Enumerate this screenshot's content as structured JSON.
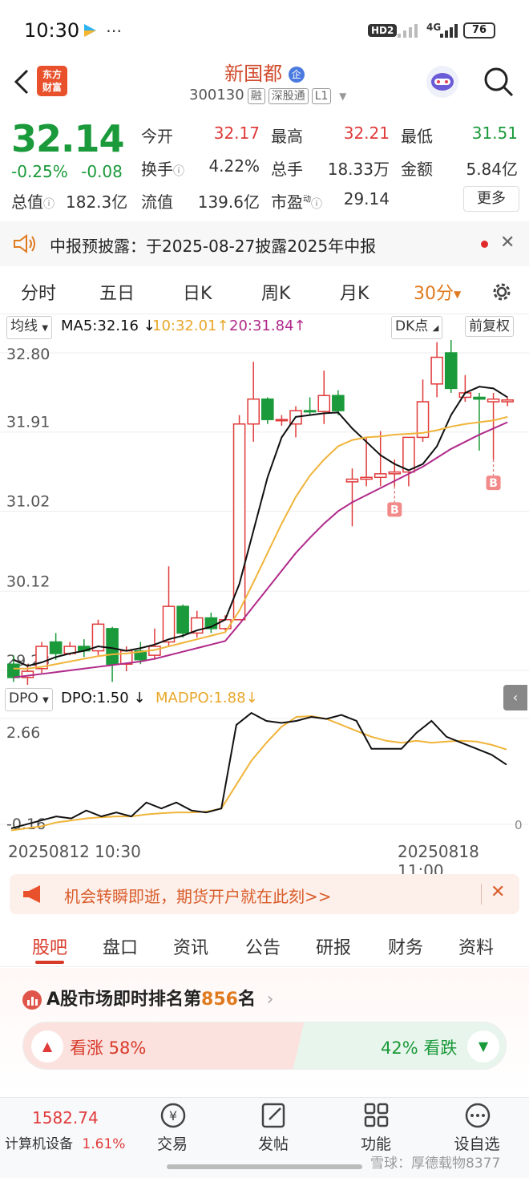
{
  "status": {
    "time": "10:30",
    "battery": "76",
    "signal_tag": "HD2",
    "network": "4G"
  },
  "header": {
    "logo_line1": "东方",
    "logo_line2": "财富",
    "name": "新国都",
    "badge": "企",
    "code": "300130",
    "tags": [
      "融",
      "深股通",
      "L1"
    ]
  },
  "quote": {
    "price": "32.14",
    "change_pct": "-0.25%",
    "change": "-0.08",
    "open_label": "今开",
    "open": "32.17",
    "high_label": "最高",
    "high": "32.21",
    "low_label": "最低",
    "low": "31.51",
    "turnover_label": "换手",
    "turnover": "4.22%",
    "volume_label": "总手",
    "volume": "18.33万",
    "amount_label": "金额",
    "amount": "5.84亿",
    "mktcap_label": "总值",
    "mktcap": "182.3亿",
    "float_label": "流值",
    "float": "139.6亿",
    "pe_label": "市盈",
    "pe_sup": "动",
    "pe": "29.14",
    "more": "更多"
  },
  "notice": {
    "text": "中报预披露：于2025-08-27披露2025年中报"
  },
  "tabs": [
    "分时",
    "五日",
    "日K",
    "周K",
    "月K",
    "30分"
  ],
  "ma": {
    "selector": "均线",
    "ma5": "MA5:32.16",
    "ma10": "10:32.01",
    "ma20": "20:31.84",
    "dk": "DK点",
    "adjust": "前复权"
  },
  "colors": {
    "up": "#e03a3a",
    "down": "#1a9a3a",
    "ma5": "#111111",
    "ma10": "#f0b43a",
    "ma20": "#b02a8a",
    "accent": "#e07a1f"
  },
  "chart_data": [
    {
      "type": "candlestick",
      "y_ticks": [
        "32.80",
        "31.91",
        "31.02",
        "30.12",
        "29.23"
      ],
      "ylim": [
        29.23,
        32.8
      ],
      "candles": [
        [
          29.3,
          29.15,
          29.1,
          29.4
        ],
        [
          29.15,
          29.22,
          29.05,
          29.3
        ],
        [
          29.25,
          29.5,
          29.2,
          29.55
        ],
        [
          29.55,
          29.42,
          29.35,
          29.65
        ],
        [
          29.42,
          29.5,
          29.4,
          29.55
        ],
        [
          29.5,
          29.45,
          29.38,
          29.58
        ],
        [
          29.45,
          29.75,
          29.4,
          29.8
        ],
        [
          29.7,
          29.3,
          29.1,
          29.72
        ],
        [
          29.3,
          29.45,
          29.22,
          29.5
        ],
        [
          29.45,
          29.35,
          29.3,
          29.55
        ],
        [
          29.4,
          29.5,
          29.35,
          29.7
        ],
        [
          29.55,
          29.95,
          29.5,
          30.4
        ],
        [
          29.95,
          29.65,
          29.6,
          29.97
        ],
        [
          29.65,
          29.82,
          29.6,
          29.9
        ],
        [
          29.82,
          29.7,
          29.65,
          29.88
        ],
        [
          29.7,
          29.8,
          29.68,
          29.85
        ],
        [
          29.8,
          32.0,
          29.8,
          32.1
        ],
        [
          32.0,
          32.28,
          31.8,
          32.7
        ],
        [
          32.28,
          32.05,
          32.0,
          32.3
        ],
        [
          32.05,
          32.05,
          31.98,
          32.1
        ],
        [
          32.0,
          32.15,
          31.85,
          32.2
        ],
        [
          32.15,
          32.14,
          32.1,
          32.3
        ],
        [
          32.14,
          32.32,
          32.0,
          32.6
        ],
        [
          32.32,
          32.15,
          32.1,
          32.38
        ],
        [
          31.35,
          31.38,
          30.85,
          31.5
        ],
        [
          31.38,
          31.4,
          31.3,
          31.85
        ],
        [
          31.4,
          31.44,
          31.3,
          31.92
        ],
        [
          31.44,
          31.46,
          31.3,
          31.6
        ],
        [
          31.46,
          31.85,
          31.3,
          31.85
        ],
        [
          31.85,
          32.25,
          31.8,
          32.5
        ],
        [
          32.45,
          32.75,
          32.3,
          32.92
        ],
        [
          32.8,
          32.4,
          32.35,
          32.95
        ],
        [
          32.3,
          32.35,
          32.25,
          32.55
        ],
        [
          32.3,
          32.28,
          31.7,
          32.35
        ],
        [
          32.25,
          32.28,
          31.6,
          32.35
        ],
        [
          32.25,
          32.27,
          32.2,
          32.3
        ]
      ],
      "ma5": [
        29.35,
        29.28,
        29.32,
        29.38,
        29.42,
        29.45,
        29.5,
        29.48,
        29.45,
        29.48,
        29.52,
        29.58,
        29.62,
        29.68,
        29.72,
        29.8,
        30.2,
        30.8,
        31.4,
        31.85,
        32.08,
        32.1,
        32.12,
        32.13,
        31.95,
        31.8,
        31.65,
        31.55,
        31.48,
        31.55,
        31.75,
        32.1,
        32.35,
        32.42,
        32.4,
        32.3
      ],
      "ma10": [
        29.25,
        29.25,
        29.27,
        29.3,
        29.33,
        29.36,
        29.39,
        29.41,
        29.42,
        29.44,
        29.46,
        29.5,
        29.54,
        29.58,
        29.62,
        29.66,
        29.9,
        30.22,
        30.55,
        30.88,
        31.18,
        31.42,
        31.6,
        31.75,
        31.82,
        31.85,
        31.86,
        31.88,
        31.89,
        31.9,
        31.93,
        31.97,
        32.0,
        32.02,
        32.04,
        32.08
      ],
      "ma20": [
        29.15,
        29.17,
        29.19,
        29.21,
        29.23,
        29.25,
        29.27,
        29.29,
        29.31,
        29.33,
        29.36,
        29.4,
        29.44,
        29.48,
        29.52,
        29.56,
        29.75,
        29.95,
        30.15,
        30.35,
        30.55,
        30.72,
        30.88,
        31.02,
        31.12,
        31.2,
        31.28,
        31.36,
        31.44,
        31.52,
        31.62,
        31.72,
        31.8,
        31.88,
        31.95,
        32.02
      ],
      "markers": [
        {
          "label": "B",
          "index": 27
        },
        {
          "label": "B",
          "index": 34
        }
      ]
    },
    {
      "type": "line",
      "name": "DPO",
      "labels": {
        "dpo": "DPO:1.50",
        "madpo": "MADPO:1.88"
      },
      "y_ticks": [
        "2.66",
        "-0.16"
      ],
      "right_tick": "0",
      "ylim": [
        -0.16,
        2.66
      ],
      "dpo": [
        -0.1,
        0.0,
        0.1,
        0.2,
        0.15,
        0.35,
        0.2,
        0.3,
        0.2,
        0.55,
        0.4,
        0.55,
        0.35,
        0.3,
        0.4,
        2.5,
        2.8,
        2.6,
        2.55,
        2.6,
        2.7,
        2.65,
        2.75,
        2.6,
        1.9,
        1.9,
        1.9,
        2.3,
        2.6,
        2.2,
        2.05,
        1.9,
        1.75,
        1.5
      ],
      "madpo": [
        -0.15,
        -0.1,
        -0.05,
        0.05,
        0.1,
        0.15,
        0.18,
        0.2,
        0.2,
        0.25,
        0.28,
        0.3,
        0.3,
        0.32,
        0.4,
        1.0,
        1.6,
        2.05,
        2.45,
        2.7,
        2.72,
        2.65,
        2.5,
        2.35,
        2.2,
        2.1,
        2.05,
        2.1,
        2.05,
        2.08,
        2.1,
        2.08,
        2.0,
        1.88
      ]
    }
  ],
  "date_range": {
    "start": "20250812 10:30",
    "end": "20250818 11:00"
  },
  "promo": {
    "text": "机会转瞬即逝，期货开户就在此刻>>"
  },
  "subtabs": [
    "股吧",
    "盘口",
    "资讯",
    "公告",
    "研报",
    "财务",
    "资料"
  ],
  "rank": {
    "prefix": "A股市场即时排名第",
    "num": "856",
    "suffix": "名"
  },
  "vote": {
    "up_label": "看涨 58%",
    "down_label": "42% 看跌",
    "up_fraction": 0.58
  },
  "bottom": {
    "index_value": "1582.74",
    "sector": "计算机设备",
    "sector_pct": "1.61%",
    "nav": [
      "交易",
      "发帖",
      "功能",
      "设自选"
    ],
    "watermark": "雪球：厚德载物8377"
  }
}
